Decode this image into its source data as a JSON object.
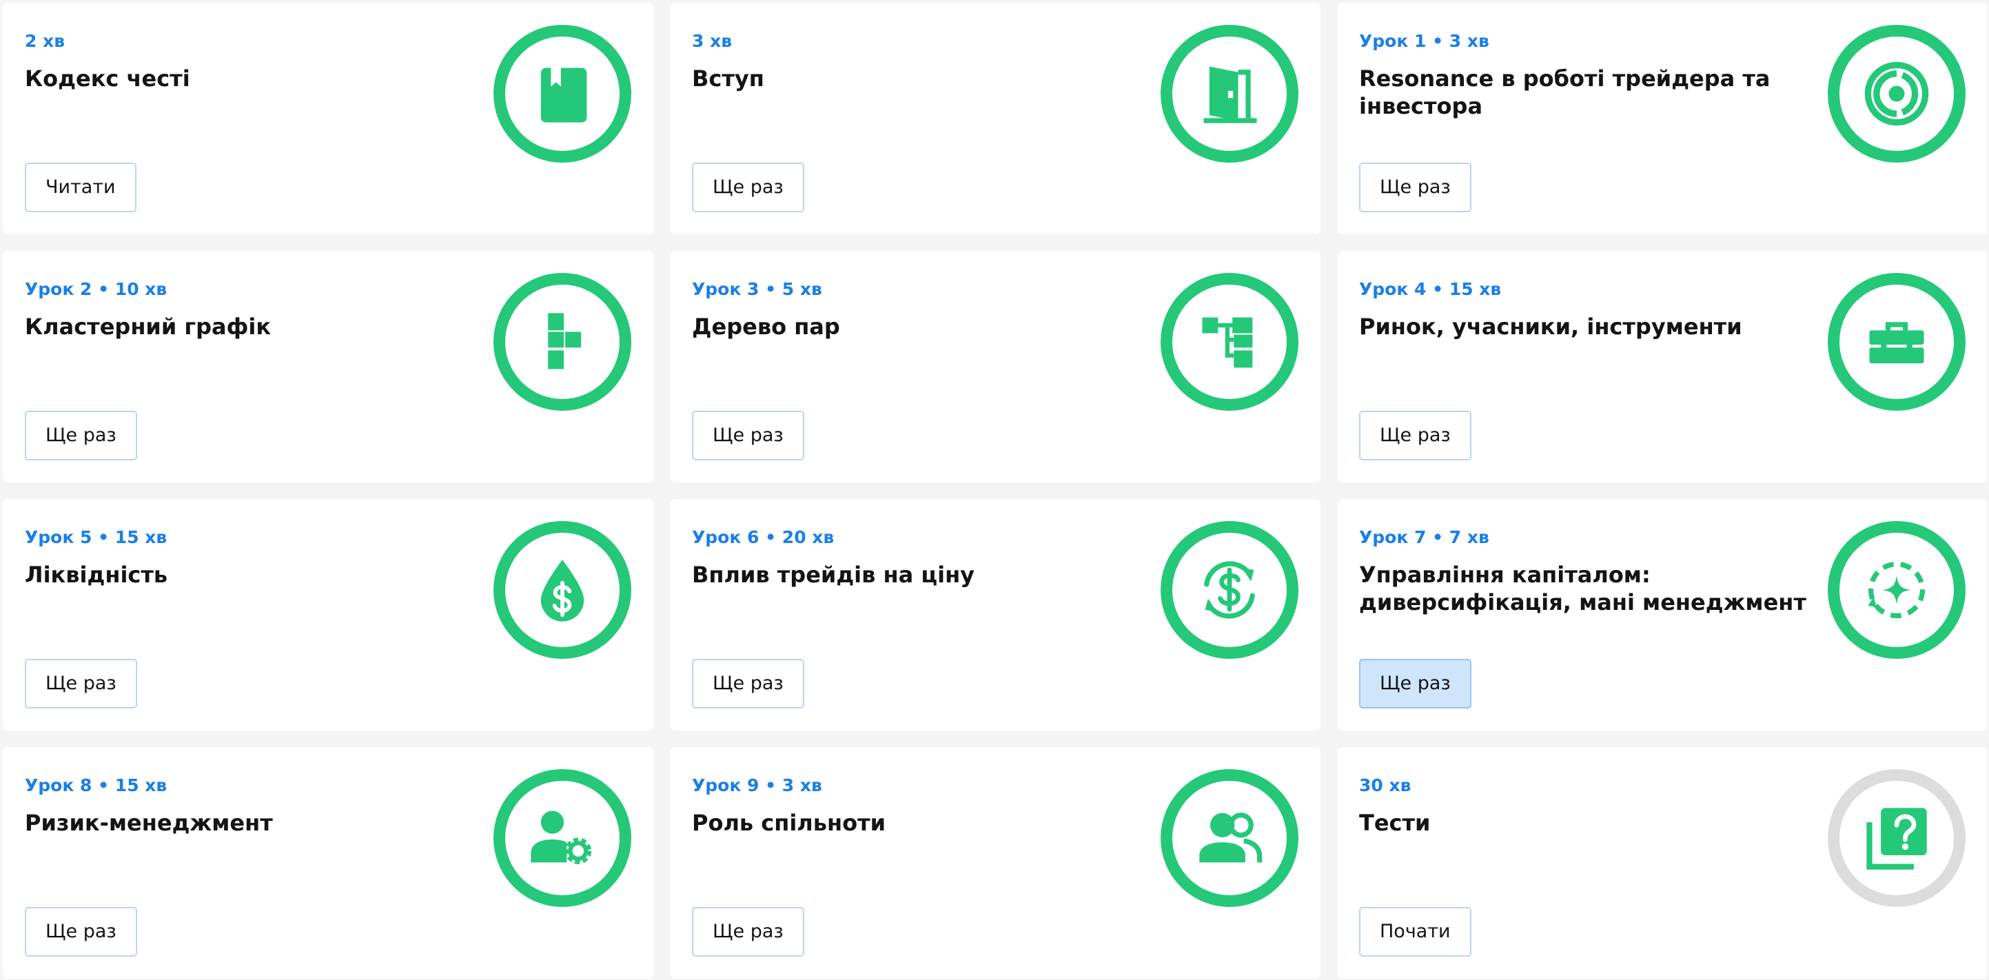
{
  "accent_color": "#24c878",
  "meta_color": "#1a7fe6",
  "cards": [
    {
      "meta": "2 хв",
      "title": "Кодекс честі",
      "button": "Читати",
      "icon": "book-icon",
      "status": "available"
    },
    {
      "meta": "3 хв",
      "title": "Вступ",
      "button": "Ще раз",
      "icon": "door-icon",
      "status": "completed"
    },
    {
      "meta": "Урок 1 • 3 хв",
      "title": "Resonance в роботі трейдера та інвестора",
      "button": "Ще раз",
      "icon": "target-icon",
      "status": "completed"
    },
    {
      "meta": "Урок 2 • 10 хв",
      "title": "Кластерний графік",
      "button": "Ще раз",
      "icon": "cluster-chart-icon",
      "status": "completed"
    },
    {
      "meta": "Урок 3 • 5 хв",
      "title": "Дерево пар",
      "button": "Ще раз",
      "icon": "tree-icon",
      "status": "completed"
    },
    {
      "meta": "Урок 4 • 15 хв",
      "title": "Ринок, учасники, інструменти",
      "button": "Ще раз",
      "icon": "toolbox-icon",
      "status": "completed"
    },
    {
      "meta": "Урок 5 • 15 хв",
      "title": "Ліквідність",
      "button": "Ще раз",
      "icon": "dollar-drop-icon",
      "status": "completed"
    },
    {
      "meta": "Урок 6 • 20 хв",
      "title": "Вплив трейдів на ціну",
      "button": "Ще раз",
      "icon": "dollar-cycle-icon",
      "status": "completed"
    },
    {
      "meta": "Урок 7 • 7 хв",
      "title": "Управління капіталом: диверсифікація, мані менеджмент",
      "button": "Ще раз",
      "icon": "sparkle-cycle-icon",
      "status": "completed",
      "button_state": "hovered"
    },
    {
      "meta": "Урок 8 • 15 хв",
      "title": "Ризик-менеджмент",
      "button": "Ще раз",
      "icon": "user-gear-icon",
      "status": "completed"
    },
    {
      "meta": "Урок 9 • 3 хв",
      "title": "Роль спільноти",
      "button": "Ще раз",
      "icon": "group-icon",
      "status": "completed"
    },
    {
      "meta": "30 хв",
      "title": "Тести",
      "button": "Почати",
      "icon": "quiz-icon",
      "status": "not-completed"
    }
  ]
}
